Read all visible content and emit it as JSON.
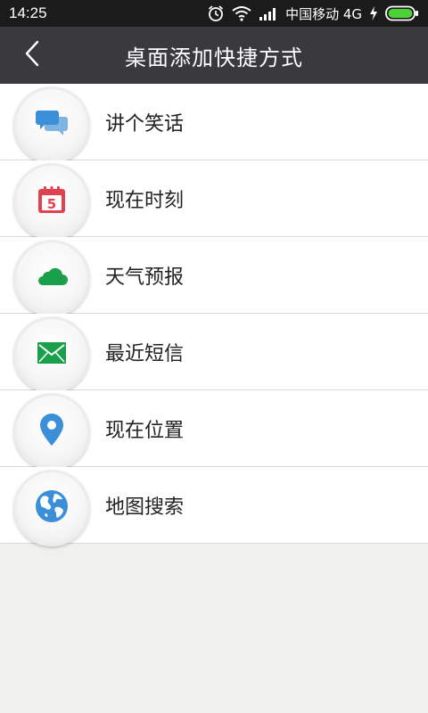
{
  "status_bar": {
    "time": "14:25",
    "carrier": "中国移动 4G",
    "icons": [
      "alarm-icon",
      "wifi-icon",
      "signal-icon",
      "charging-icon",
      "battery-icon"
    ]
  },
  "header": {
    "title": "桌面添加快捷方式",
    "back_icon": "chevron-left-icon",
    "background": "#3a3a3e"
  },
  "shortcuts": [
    {
      "label": "讲个笑话",
      "icon": "chat-bubbles-icon",
      "color": "#3b8fd9"
    },
    {
      "label": "现在时刻",
      "icon": "calendar-icon",
      "color": "#e0434f",
      "calendar_day": "5"
    },
    {
      "label": "天气预报",
      "icon": "cloud-icon",
      "color": "#1a9f4b"
    },
    {
      "label": "最近短信",
      "icon": "envelope-icon",
      "color": "#1a9f4b"
    },
    {
      "label": "现在位置",
      "icon": "location-pin-icon",
      "color": "#3b8fd9"
    },
    {
      "label": "地图搜索",
      "icon": "globe-icon",
      "color": "#3b8fd9"
    }
  ]
}
